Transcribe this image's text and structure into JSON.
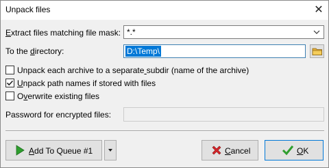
{
  "window": {
    "title": "Unpack files"
  },
  "form": {
    "mask_label": "Extract files matching file mask:",
    "mask_value": "*.*",
    "directory_label": "To the directory:",
    "directory_value": "D:\\Temp\\",
    "separate_subdir_label": "Unpack each archive to a separate subdir (name of the archive)",
    "separate_subdir_checked": false,
    "unpack_paths_label": "Unpack path names if stored with files",
    "unpack_paths_checked": true,
    "overwrite_label": "Overwrite existing files",
    "overwrite_checked": false,
    "password_label": "Password for encrypted files:",
    "password_value": ""
  },
  "buttons": {
    "queue_label": "Add To Queue #1",
    "cancel_label": "Cancel",
    "ok_label": "OK"
  },
  "icons": {
    "close": "close-icon",
    "dropdown": "chevron-down-icon",
    "browse": "folder-icon",
    "queue": "play-arrow-icon",
    "cancel": "red-x-icon",
    "ok": "checkmark-icon"
  },
  "colors": {
    "selection": "#0078d7",
    "play_green": "#2e9e2e",
    "cancel_red": "#d6262b",
    "ok_green": "#2e9e2e"
  }
}
